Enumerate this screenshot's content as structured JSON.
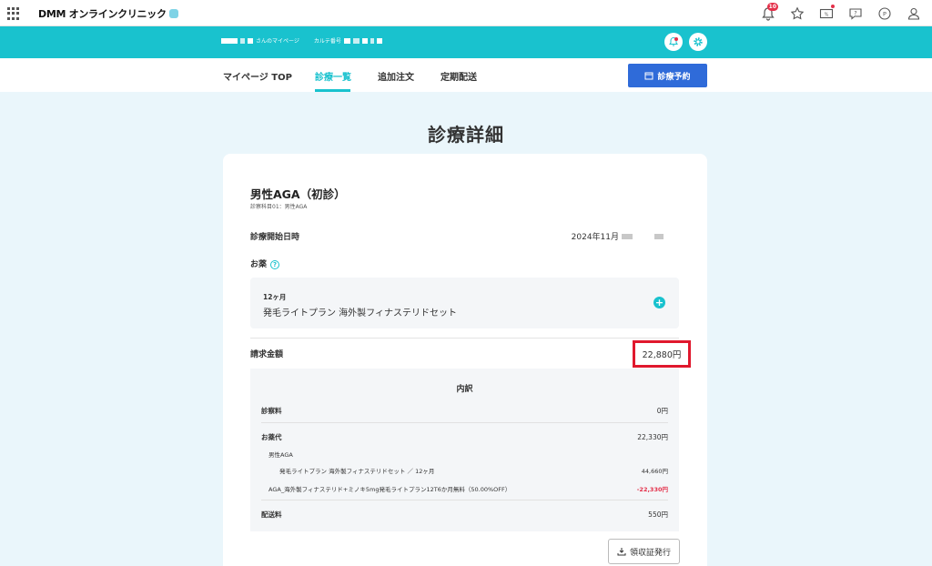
{
  "topbar": {
    "brand": "DMM オンラインクリニック",
    "notification_count": "10",
    "icons": [
      "grid-icon",
      "bell-icon",
      "star-icon",
      "percent-ticket-icon",
      "chat-icon",
      "points-icon",
      "user-icon"
    ]
  },
  "header": {
    "greeting_suffix": "さんのマイページ",
    "chart_number_label": "カルテ番号",
    "icons": [
      "notification-icon",
      "settings-icon"
    ]
  },
  "nav": {
    "items": [
      {
        "label": "マイページ TOP"
      },
      {
        "label": "診療一覧"
      },
      {
        "label": "追加注文"
      },
      {
        "label": "定期配送"
      }
    ],
    "active_item": "診療一覧",
    "reserve_button": "診療予約",
    "reserve_icon": "calendar-icon"
  },
  "page": {
    "title": "診療詳細"
  },
  "detail": {
    "plan_title": "男性AGA（初診）",
    "plan_subtitle": "診察科目01：男性AGA",
    "start_label": "診療開始日時",
    "start_value": "2024年11月",
    "medicine_label": "お薬",
    "medicine_help_icon": "question-circle-icon",
    "medicine_duration": "12ヶ月",
    "medicine_name": "発毛ライトプラン 海外製フィナステリドセット",
    "expand_icon": "plus-circle-icon",
    "billing_label": "請求金額",
    "billing_total": "22,880円",
    "highlight_color": "#e0182d"
  },
  "breakdown": {
    "title": "内訳",
    "consult_label": "診察料",
    "consult_value": "0円",
    "medicine_label": "お薬代",
    "medicine_value": "22,330円",
    "category": "男性AGA",
    "item_name": "発毛ライトプラン 海外製フィナステリドセット ／ 12ヶ月",
    "item_value": "44,660円",
    "discount_name": "AGA_海外製フィナステリド+ミノキ5mg発毛ライトプラン12T6か月無料（50.00%OFF）",
    "discount_value": "-22,330円",
    "shipping_label": "配送料",
    "shipping_value": "550円"
  },
  "receipt_button": "領収証発行",
  "colors": {
    "teal": "#19c2ce",
    "button_blue": "#2f6bd9",
    "background": "#eaf6fb",
    "negative": "#e4304a"
  }
}
